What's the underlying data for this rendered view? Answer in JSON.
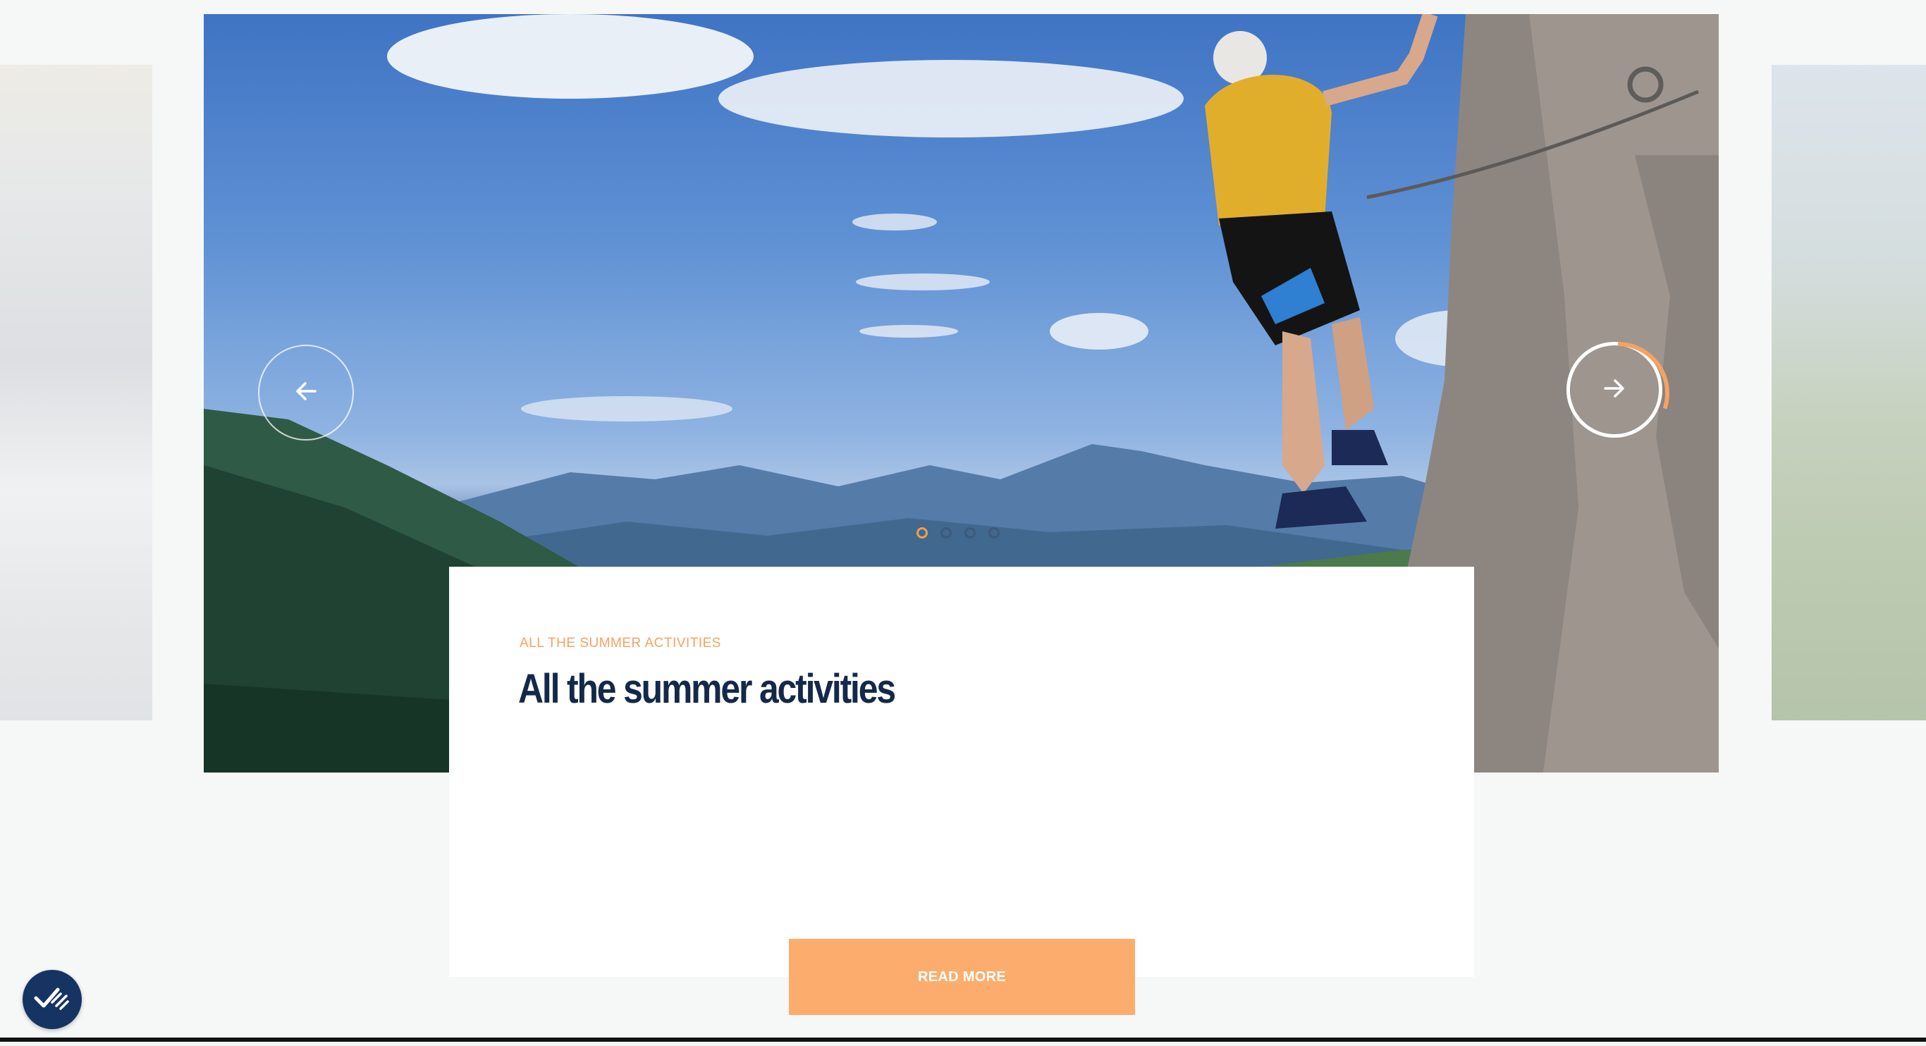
{
  "carousel": {
    "prev_icon": "arrow-left-icon",
    "next_icon": "arrow-right-icon",
    "autoplay_progress": 0.3,
    "slide_count": 4,
    "active_index": 0
  },
  "card": {
    "eyebrow": "ALL THE SUMMER ACTIVITIES",
    "title": "All the summer activities",
    "button_label": "READ MORE"
  },
  "badge": {
    "icon": "double-check-icon"
  },
  "colors": {
    "accent": "#f5a262",
    "button": "#fcad6d",
    "title": "#14294a",
    "badge": "#163462"
  }
}
